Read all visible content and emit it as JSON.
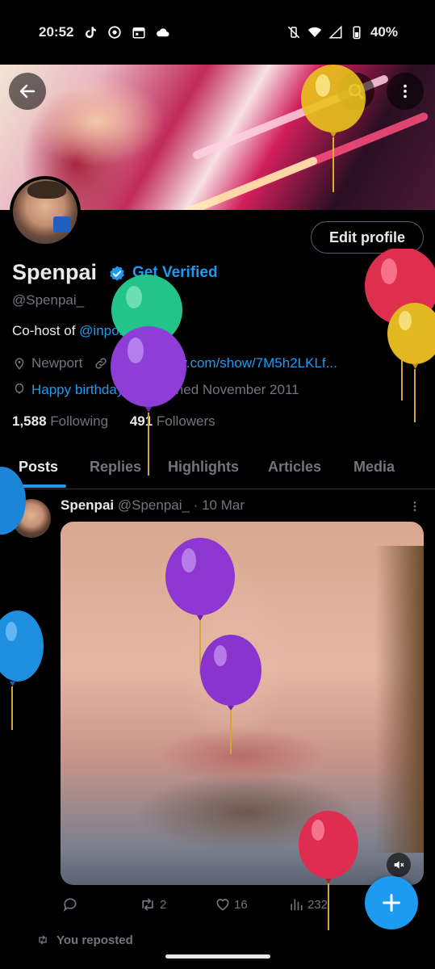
{
  "status_bar": {
    "time": "20:52",
    "battery": "40%",
    "left_icons": [
      "tiktok-icon",
      "chrome-icon",
      "calendar-icon",
      "cloud-icon"
    ],
    "right_icons": [
      "vibrate-off-icon",
      "wifi-icon",
      "signal-icon",
      "battery-icon"
    ]
  },
  "header": {
    "back_icon": "arrow-left-icon",
    "search_icon": "search-icon",
    "more_icon": "more-vertical-icon"
  },
  "profile": {
    "edit_label": "Edit profile",
    "name": "Spenpai",
    "get_verified": "Get Verified",
    "handle": "@Spenpai_",
    "bio_prefix": "Co-host of ",
    "bio_mention": "@inpoistrust",
    "bio_suffix": "!",
    "location": "Newport",
    "link": "open.spotify.com/show/7M5h2LKLf...",
    "birthday": "Happy birthday!",
    "joined": "Joined November 2011",
    "following_count": "1,588",
    "following_label": " Following",
    "followers_count": "491",
    "followers_label": " Followers"
  },
  "tabs": [
    {
      "label": "Posts"
    },
    {
      "label": "Replies"
    },
    {
      "label": "Highlights"
    },
    {
      "label": "Articles"
    },
    {
      "label": "Media"
    }
  ],
  "post": {
    "author": "Spenpai",
    "handle": "@Spenpai_",
    "date": "· 10 Mar",
    "actions": {
      "replies": "",
      "reposts": "2",
      "likes": "16",
      "views": "232"
    }
  },
  "next_item": {
    "label": "You reposted"
  },
  "colors": {
    "accent": "#1d9bf0",
    "background": "#000000",
    "text": "#e7e9ea",
    "muted": "#71767b"
  }
}
